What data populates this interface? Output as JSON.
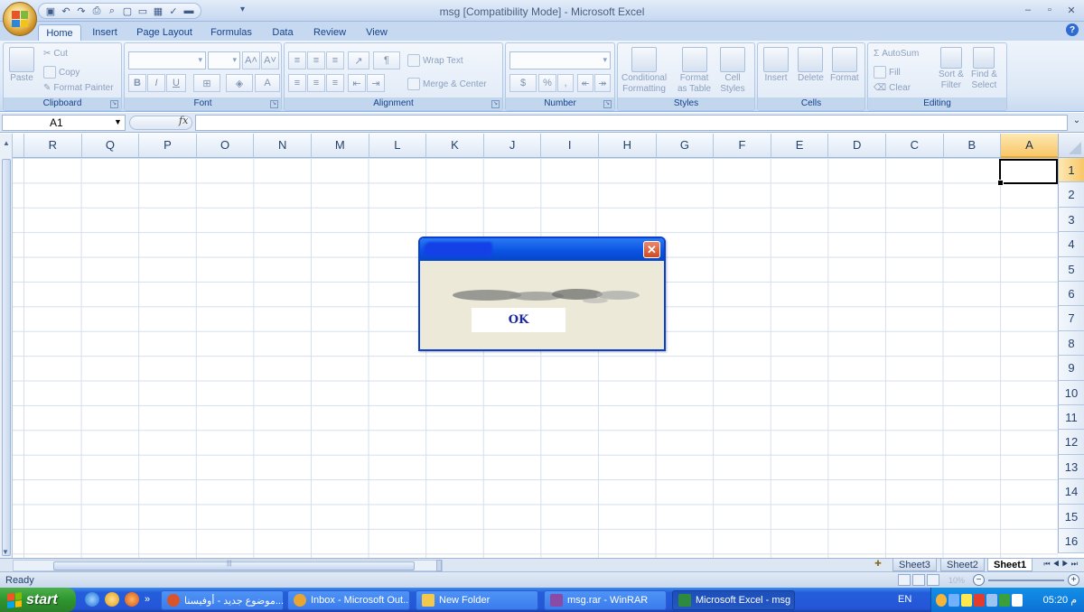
{
  "window": {
    "title": "msg  [Compatibility Mode] - Microsoft Excel",
    "qat_more": "▾",
    "controls": [
      "–",
      "▫",
      "✕"
    ]
  },
  "ribbon_tabs": [
    {
      "label": "Home"
    },
    {
      "label": "Insert"
    },
    {
      "label": "Page Layout"
    },
    {
      "label": "Formulas"
    },
    {
      "label": "Data"
    },
    {
      "label": "Review"
    },
    {
      "label": "View"
    }
  ],
  "help_label": "?",
  "ribbon": {
    "clipboard": {
      "label": "Clipboard",
      "paste": "Paste",
      "cut": "Cut",
      "copy": "Copy",
      "format_painter": "Format Painter"
    },
    "font": {
      "label": "Font",
      "grow": "A˄",
      "shrink": "A˅",
      "bold": "B",
      "italic": "I",
      "underline": "U",
      "font_color": "A"
    },
    "alignment": {
      "label": "Alignment",
      "wrap_text": "Wrap Text",
      "merge_center": "Merge & Center"
    },
    "number": {
      "label": "Number",
      "percent": "%",
      "comma": ","
    },
    "styles": {
      "label": "Styles",
      "conditional_1": "Conditional",
      "conditional_2": "Formatting",
      "format_table_1": "Format",
      "format_table_2": "as Table",
      "cell_styles_1": "Cell",
      "cell_styles_2": "Styles"
    },
    "cells": {
      "label": "Cells",
      "insert": "Insert",
      "delete": "Delete",
      "format": "Format"
    },
    "editing": {
      "label": "Editing",
      "autosum": "AutoSum",
      "fill": "Fill",
      "clear": "Clear",
      "sort_1": "Sort &",
      "sort_2": "Filter",
      "find_1": "Find &",
      "find_2": "Select"
    }
  },
  "formula_bar": {
    "name_box": "A1",
    "fx": "fx",
    "value": ""
  },
  "columns": [
    "R",
    "Q",
    "P",
    "O",
    "N",
    "M",
    "L",
    "K",
    "J",
    "I",
    "H",
    "G",
    "F",
    "E",
    "D",
    "C",
    "B",
    "A"
  ],
  "active_column": "A",
  "rows": [
    "1",
    "2",
    "3",
    "4",
    "5",
    "6",
    "7",
    "8",
    "9",
    "10",
    "11",
    "12",
    "13",
    "14",
    "15",
    "16"
  ],
  "active_row": "1",
  "dialog": {
    "ok_label": "OK",
    "close_label": "✕"
  },
  "sheet_tabs": [
    {
      "label": "Sheet3",
      "active": false
    },
    {
      "label": "Sheet2",
      "active": false
    },
    {
      "label": "Sheet1",
      "active": true
    }
  ],
  "tab_nav": "⏮◀▶⏭",
  "status": {
    "ready": "Ready",
    "zoom_pct": "10%"
  },
  "taskbar": {
    "start": "start",
    "tasks": [
      {
        "label": "موضوع جديد - أوفيسنا...",
        "icon_color": "#d9542b",
        "active": false
      },
      {
        "label": "Inbox - Microsoft Out...",
        "icon_color": "#e8a531",
        "active": false
      },
      {
        "label": "New Folder",
        "icon_color": "#f2c94c",
        "active": false
      },
      {
        "label": "msg.rar - WinRAR",
        "icon_color": "#8b4aa6",
        "active": false
      },
      {
        "label": "Microsoft Excel - msg ...",
        "icon_color": "#2e8b3d",
        "active": true
      }
    ],
    "language": "EN",
    "clock": "05:20 م",
    "quick_more": "»"
  }
}
